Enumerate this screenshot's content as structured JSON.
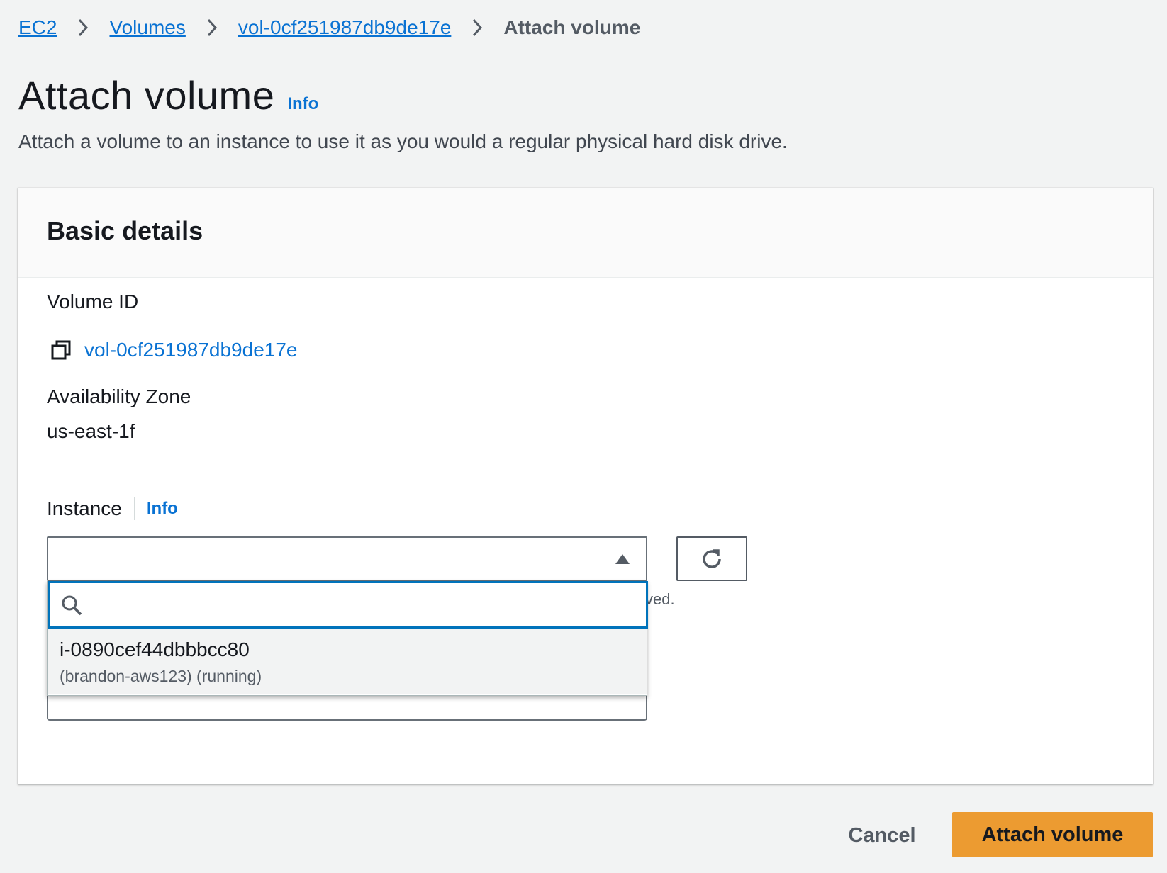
{
  "breadcrumb": {
    "items": [
      {
        "label": "EC2"
      },
      {
        "label": "Volumes"
      },
      {
        "label": "vol-0cf251987db9de17e"
      }
    ],
    "current": "Attach volume"
  },
  "header": {
    "title": "Attach volume",
    "info": "Info",
    "description": "Attach a volume to an instance to use it as you would a regular physical hard disk drive."
  },
  "panel": {
    "title": "Basic details",
    "volume_id_label": "Volume ID",
    "volume_id": "vol-0cf251987db9de17e",
    "az_label": "Availability Zone",
    "az_value": "us-east-1f",
    "instance_label": "Instance",
    "instance_info": "Info",
    "instance_select_value": "",
    "search_value": "",
    "hint_partial": "ved.",
    "options": [
      {
        "id": "i-0890cef44dbbbcc80",
        "detail": "(brandon-aws123) (running)"
      }
    ]
  },
  "footer": {
    "cancel": "Cancel",
    "submit": "Attach volume"
  },
  "colors": {
    "link": "#0972d3",
    "primary": "#ec9b31",
    "focus": "#0073bb",
    "background": "#f2f3f3"
  }
}
